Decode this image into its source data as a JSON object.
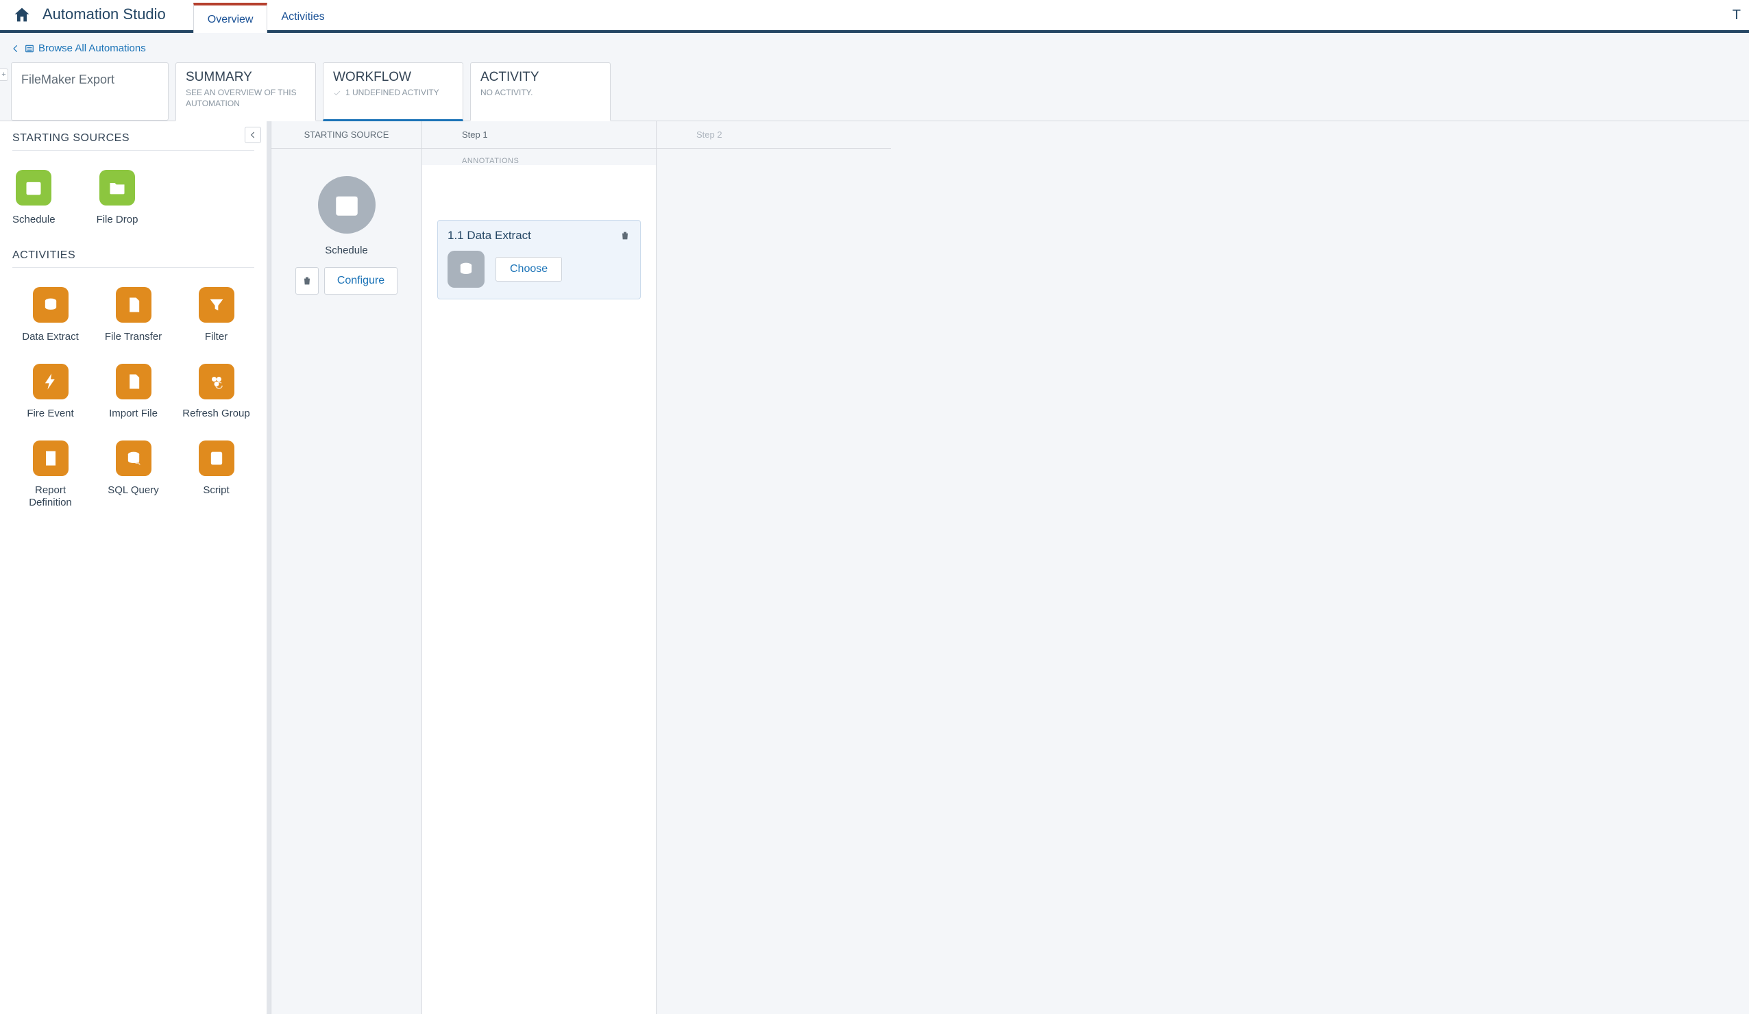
{
  "app": {
    "title": "Automation Studio",
    "right_letter": "T"
  },
  "nav": {
    "tabs": [
      "Overview",
      "Activities"
    ],
    "active_index": 0
  },
  "breadcrumb": {
    "label": "Browse All Automations"
  },
  "automation": {
    "name": "FileMaker Export"
  },
  "panels": {
    "summary": {
      "title": "SUMMARY",
      "sub": "SEE AN OVERVIEW OF THIS AUTOMATION"
    },
    "workflow": {
      "title": "WORKFLOW",
      "sub": "1 UNDEFINED ACTIVITY"
    },
    "activity": {
      "title": "ACTIVITY",
      "sub": "NO ACTIVITY."
    },
    "active": "workflow"
  },
  "sidebar": {
    "sources_heading": "STARTING SOURCES",
    "activities_heading": "ACTIVITIES",
    "sources": [
      {
        "label": "Schedule",
        "icon": "calendar"
      },
      {
        "label": "File Drop",
        "icon": "folder-down"
      }
    ],
    "activities": [
      {
        "label": "Data Extract",
        "icon": "data-extract"
      },
      {
        "label": "File Transfer",
        "icon": "file-transfer"
      },
      {
        "label": "Filter",
        "icon": "filter"
      },
      {
        "label": "Fire Event",
        "icon": "bolt"
      },
      {
        "label": "Import File",
        "icon": "import-file"
      },
      {
        "label": "Refresh Group",
        "icon": "refresh-group"
      },
      {
        "label": "Report Definition",
        "icon": "report"
      },
      {
        "label": "SQL Query",
        "icon": "sql"
      },
      {
        "label": "Script",
        "icon": "script"
      }
    ]
  },
  "canvas": {
    "start_heading": "STARTING SOURCE",
    "step1_heading": "Step 1",
    "step2_heading": "Step 2",
    "annotations_label": "ANNOTATIONS",
    "start": {
      "label": "Schedule",
      "configure_label": "Configure"
    },
    "step1": {
      "activity_title": "1.1 Data Extract",
      "choose_label": "Choose"
    }
  }
}
